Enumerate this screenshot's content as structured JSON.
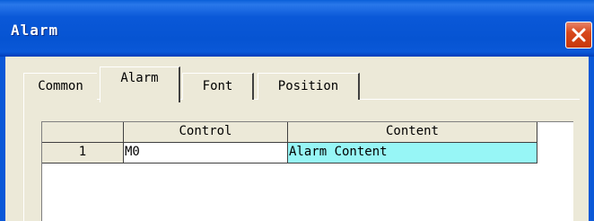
{
  "window": {
    "title": "Alarm",
    "close_icon": "close-icon"
  },
  "tabs": [
    {
      "label": "Common",
      "selected": false
    },
    {
      "label": "Alarm",
      "selected": true
    },
    {
      "label": "Font",
      "selected": false
    },
    {
      "label": "Position",
      "selected": false
    }
  ],
  "grid": {
    "columns": [
      "Control",
      "Content"
    ],
    "rows": [
      {
        "index": "1",
        "control": "M0",
        "content": "Alarm Content"
      }
    ]
  },
  "colors": {
    "titlebar": "#0a58d8",
    "content_cell_highlight": "#97f6f6",
    "dialog_background": "#ece9d8",
    "close_button": "#d8481c"
  }
}
